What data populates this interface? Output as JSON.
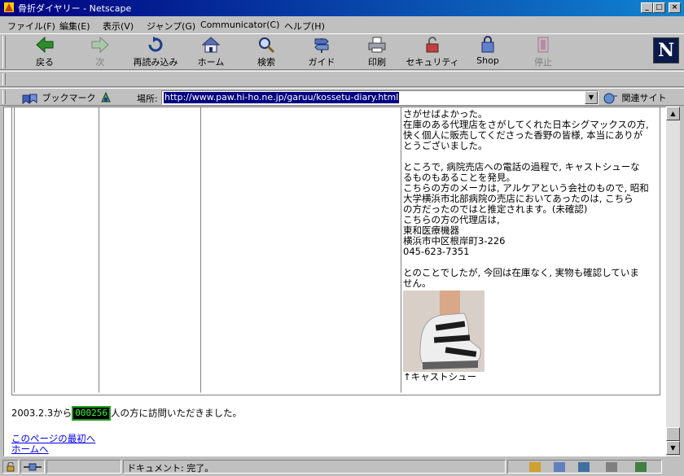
{
  "window": {
    "title": "骨折ダイヤリー - Netscape"
  },
  "menu": [
    "ファイル(F)",
    "編集(E)",
    "表示(V)",
    "ジャンプ(G)",
    "Communicator(C)",
    "ヘルプ(H)"
  ],
  "toolbar": {
    "back": "戻る",
    "forward": "次",
    "reload": "再読み込み",
    "home": "ホーム",
    "search": "検索",
    "guide": "ガイド",
    "print": "印刷",
    "security": "セキュリティ",
    "shop": "Shop",
    "stop": "停止",
    "logo": "N"
  },
  "location": {
    "bookmarks": "ブックマーク",
    "label": "場所:",
    "url": "http://www.paw.hi-ho.ne.jp/garuu/kossetu-diary.html",
    "related": "関連サイト"
  },
  "content": {
    "para1": [
      "さがせばよかった。",
      "在庫のある代理店をさがしてくれた日本シグマックスの方,",
      "快く個人に販売してくださった香野の皆様, 本当にありが",
      "とうございました。"
    ],
    "para2": [
      "ところで, 病院売店への電話の過程で, キャストシューな",
      "るものもあることを発見。",
      "こちらの方のメーカは, アルケアという会社のもので, 昭和",
      "大学横浜市北部病院の売店においてあったのは, こちら",
      "の方だったのではと推定されます。(未確認)",
      "こちらの方の代理店は,",
      "東和医療機器",
      "横浜市中区根岸町3-226",
      "045-623-7351"
    ],
    "para3": [
      "とのことでしたが, 今回は在庫なく, 実物も確認していま",
      "せん。"
    ],
    "caption": "↑キャストシュー",
    "counter_prefix": "2003.2.3から",
    "counter_value": "000256",
    "counter_suffix": "人の方に訪問いただきました。",
    "link_top": "このページの最初へ",
    "link_home": "ホームへ"
  },
  "status": {
    "text": "ドキュメント: 完了。"
  }
}
